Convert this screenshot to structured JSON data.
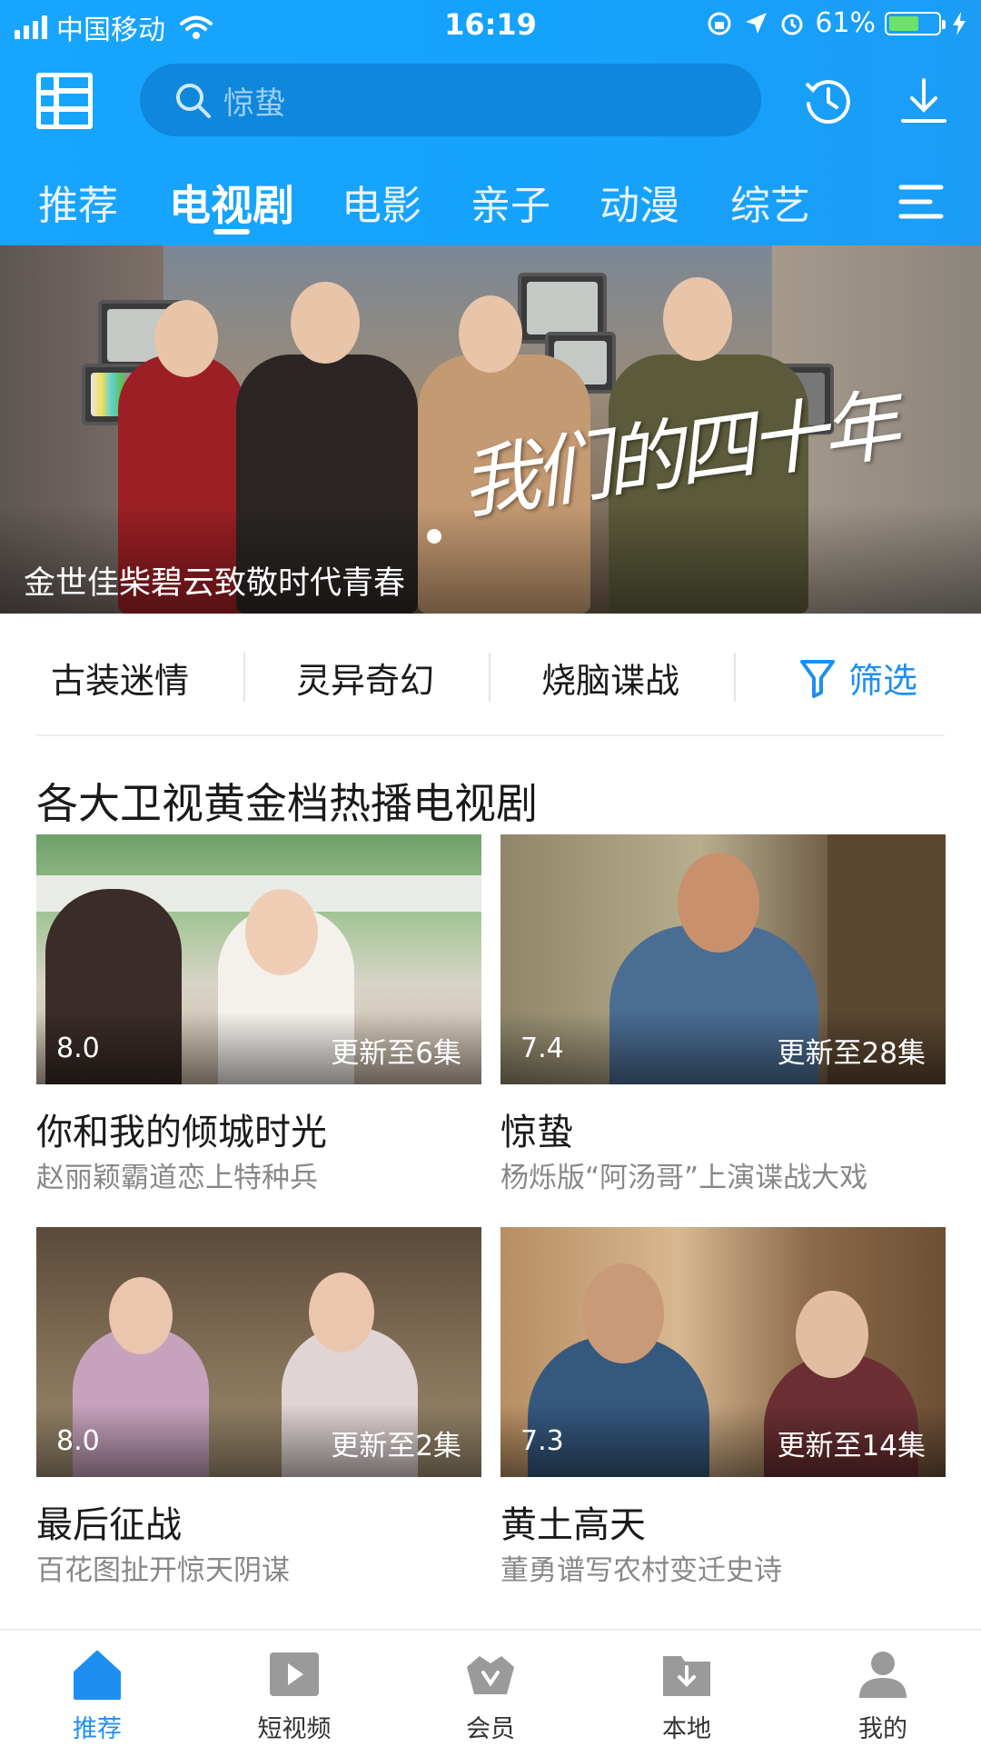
{
  "status_bar": {
    "carrier": "中国移动",
    "time": "16:19",
    "battery": "61%",
    "battery_level": 0.61
  },
  "header": {
    "search_placeholder": "惊蛰",
    "tabs": [
      {
        "label": "推荐",
        "active": false
      },
      {
        "label": "电视剧",
        "active": true
      },
      {
        "label": "电影",
        "active": false
      },
      {
        "label": "亲子",
        "active": false
      },
      {
        "label": "动漫",
        "active": false
      },
      {
        "label": "综艺",
        "active": false
      }
    ],
    "icons": [
      "category-grid-icon",
      "search-icon",
      "history-clock-icon",
      "download-icon",
      "menu-icon"
    ]
  },
  "banner": {
    "poster_title": "我们的四十年",
    "caption": "金世佳柴碧云致敬时代青春"
  },
  "genres": {
    "items": [
      "古装迷情",
      "灵异奇幻",
      "烧脑谍战"
    ],
    "filter_label": "筛选"
  },
  "section": {
    "title": "各大卫视黄金档热播电视剧",
    "cards": [
      {
        "score": "8.0",
        "update": "更新至6集",
        "title": "你和我的倾城时光",
        "subtitle": "赵丽颖霸道恋上特种兵"
      },
      {
        "score": "7.4",
        "update": "更新至28集",
        "title": "惊蛰",
        "subtitle": "杨烁版“阿汤哥”上演谍战大戏"
      },
      {
        "score": "8.0",
        "update": "更新至2集",
        "title": "最后征战",
        "subtitle": "百花图扯开惊天阴谋"
      },
      {
        "score": "7.3",
        "update": "更新至14集",
        "title": "黄土高天",
        "subtitle": "董勇谱写农村变迁史诗"
      }
    ]
  },
  "bottom_nav": {
    "items": [
      {
        "label": "推荐",
        "icon": "home-icon",
        "active": true
      },
      {
        "label": "短视频",
        "icon": "play-icon",
        "active": false
      },
      {
        "label": "会员",
        "icon": "vip-crown-icon",
        "active": false
      },
      {
        "label": "本地",
        "icon": "local-download-icon",
        "active": false
      },
      {
        "label": "我的",
        "icon": "profile-icon",
        "active": false
      }
    ]
  },
  "colors": {
    "brand_blue": "#17a5ff",
    "accent": "#1e8ff0",
    "muted_text": "#888888"
  }
}
